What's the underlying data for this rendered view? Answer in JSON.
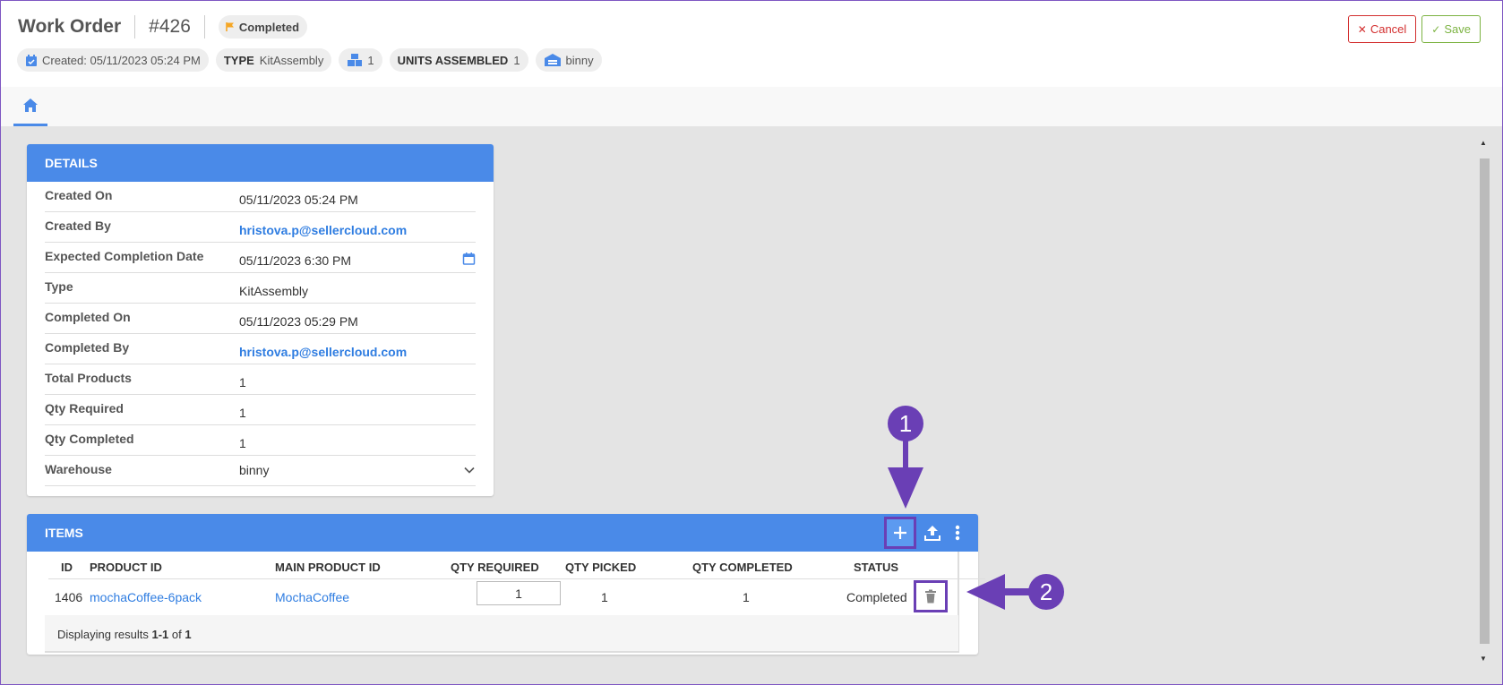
{
  "header": {
    "title": "Work Order",
    "order_number": "#426",
    "status": "Completed",
    "chips": {
      "created": "Created: 05/11/2023 05:24 PM",
      "type_label": "TYPE",
      "type_value": "KitAssembly",
      "products_count": "1",
      "units_label": "UNITS ASSEMBLED",
      "units_value": "1",
      "warehouse": "binny"
    },
    "cancel_label": "Cancel",
    "save_label": "Save"
  },
  "details": {
    "heading": "DETAILS",
    "rows": [
      {
        "label": "Created On",
        "value": "05/11/2023 05:24 PM"
      },
      {
        "label": "Created By",
        "value": "hristova.p@sellercloud.com"
      },
      {
        "label": "Expected Completion Date",
        "value": "05/11/2023 6:30 PM"
      },
      {
        "label": "Type",
        "value": "KitAssembly"
      },
      {
        "label": "Completed On",
        "value": "05/11/2023 05:29 PM"
      },
      {
        "label": "Completed By",
        "value": "hristova.p@sellercloud.com"
      },
      {
        "label": "Total Products",
        "value": "1"
      },
      {
        "label": "Qty Required",
        "value": "1"
      },
      {
        "label": "Qty Completed",
        "value": "1"
      },
      {
        "label": "Warehouse",
        "value": "binny"
      }
    ]
  },
  "items": {
    "heading": "ITEMS",
    "columns": [
      "ID",
      "PRODUCT ID",
      "MAIN PRODUCT ID",
      "QTY REQUIRED",
      "QTY PICKED",
      "QTY COMPLETED",
      "STATUS"
    ],
    "rows": [
      {
        "id": "1406",
        "product_id": "mochaCoffee-6pack",
        "main_product_id": "MochaCoffee",
        "qty_required": "1",
        "qty_picked": "1",
        "qty_completed": "1",
        "status": "Completed"
      }
    ],
    "pager": {
      "prefix": "Displaying results ",
      "range": "1-1",
      "of": " of ",
      "total": "1"
    }
  },
  "annotations": [
    "1",
    "2"
  ],
  "colors": {
    "accent": "#4a8ae8",
    "annotation": "#6a3fb5",
    "link": "#2f7de1",
    "cancel": "#d32f2f",
    "save": "#7cb342",
    "status_flag": "#f5a623"
  }
}
